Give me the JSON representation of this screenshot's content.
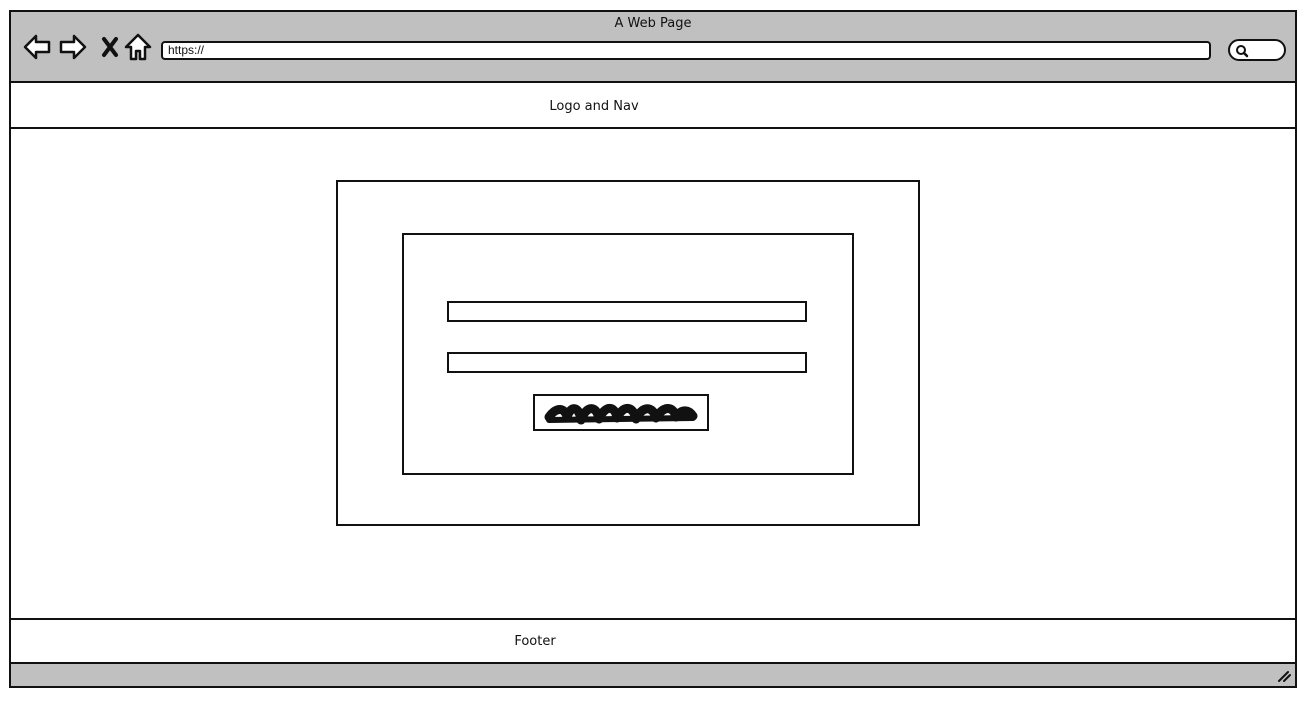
{
  "window": {
    "title": "A Web Page"
  },
  "browser": {
    "url": "https://",
    "nav_icons": [
      "back-arrow-icon",
      "forward-arrow-icon",
      "close-icon",
      "home-icon"
    ],
    "search_icon": "search-icon"
  },
  "header": {
    "label": "Logo and Nav"
  },
  "login": {
    "field_1_value": "",
    "field_2_value": "",
    "submit_label_icon": "scribble-text-placeholder"
  },
  "footer": {
    "label": "Footer"
  },
  "colors": {
    "chrome": "#c0c0c0",
    "stroke": "#111111",
    "background": "#ffffff"
  }
}
